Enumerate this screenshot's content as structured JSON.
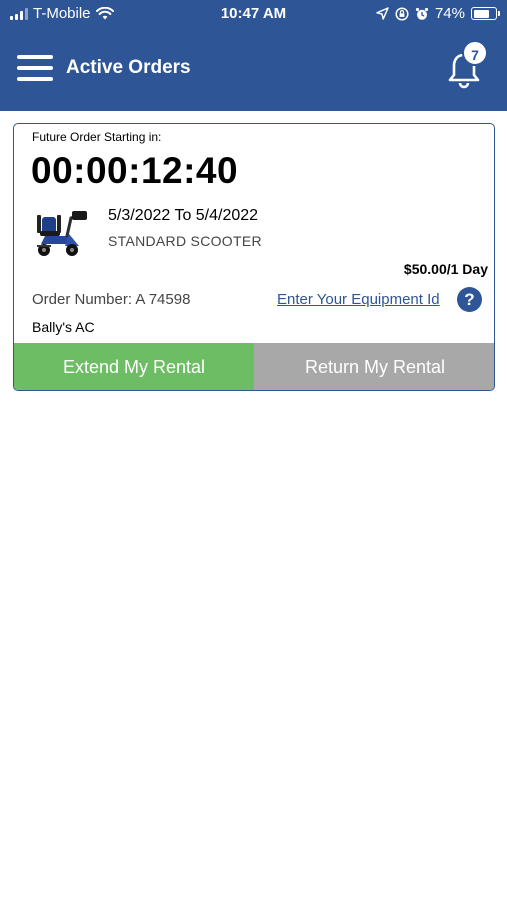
{
  "status_bar": {
    "carrier": "T-Mobile",
    "time": "10:47 AM",
    "battery": "74%",
    "battery_level": 0.74,
    "icons": [
      "signal-icon",
      "wifi-icon",
      "location-arrow-icon",
      "screen-lock-icon",
      "alarm-icon",
      "battery-icon"
    ]
  },
  "header": {
    "title": "Active Orders",
    "notification_count": "7",
    "icons": [
      "hamburger-menu-icon",
      "bell-icon"
    ]
  },
  "order": {
    "future_label": "Future Order Starting in:",
    "countdown": "00:00:12:40",
    "dates": "5/3/2022 To 5/4/2022",
    "product": "STANDARD SCOOTER",
    "price": "$50.00/1 Day",
    "order_number": "Order Number: A 74598",
    "equipment_link": "Enter Your Equipment Id",
    "help_symbol": "?",
    "location": "Bally's AC",
    "image": "scooter-image"
  },
  "actions": {
    "extend": "Extend My Rental",
    "return": "Return My Rental"
  },
  "colors": {
    "header_blue": "#2e5596",
    "extend_green": "#6cbd63",
    "return_gray": "#a8a8a8"
  }
}
